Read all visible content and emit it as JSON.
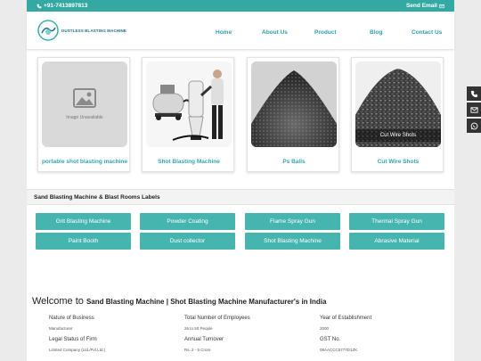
{
  "topbar": {
    "phone": "+91-7413897813",
    "send_email": "Send Email"
  },
  "header": {
    "logo_text": "DUSTLESS BLASTING MACHINE",
    "nav": [
      "Home",
      "About Us",
      "Product",
      "Blog",
      "Contact Us"
    ]
  },
  "products": [
    {
      "title": "portable shot blasting machine",
      "image_note": "Image Unavailable"
    },
    {
      "title": "Shot Blasting Machine"
    },
    {
      "title": "Ps Balls"
    },
    {
      "title": "Cut Wire Shots",
      "overlay": "Cut Wire Shots"
    }
  ],
  "section_title": "Sand Blasting Machine & Blast Rooms Labels",
  "tiles": [
    "Grit Blasting Machine",
    "Powder Coating",
    "Flame Spray Gun",
    "Thermal Spray Gun",
    "Paint Booth",
    "Dust collector",
    "Shot Blasting Machine",
    "Abrasive Material"
  ],
  "welcome": {
    "prefix": "Welcome to",
    "name": "Sand Blasting Machine | Shot Blasting Machine Manufacturer's in India"
  },
  "facts": [
    {
      "label": "Nature of Business",
      "value": "Manufacturer"
    },
    {
      "label": "Total Number of Employees",
      "value": "26 to 50 People"
    },
    {
      "label": "Year of Establishment",
      "value": "2000"
    },
    {
      "label": "Legal Status of Firm",
      "value": "Limited Company (Ltd./Pvt.Ltd.)"
    },
    {
      "label": "Annual Turnover",
      "value": "Rs. 2 - 5 Crore"
    },
    {
      "label": "GST No.",
      "value": "08AACCC5777D1ZK"
    }
  ],
  "side_icons": [
    "phone-icon",
    "mail-icon",
    "whatsapp-icon"
  ],
  "colors": {
    "teal": "#34a9a4",
    "tile": "#46b5b0",
    "link": "#2e9fb0"
  }
}
